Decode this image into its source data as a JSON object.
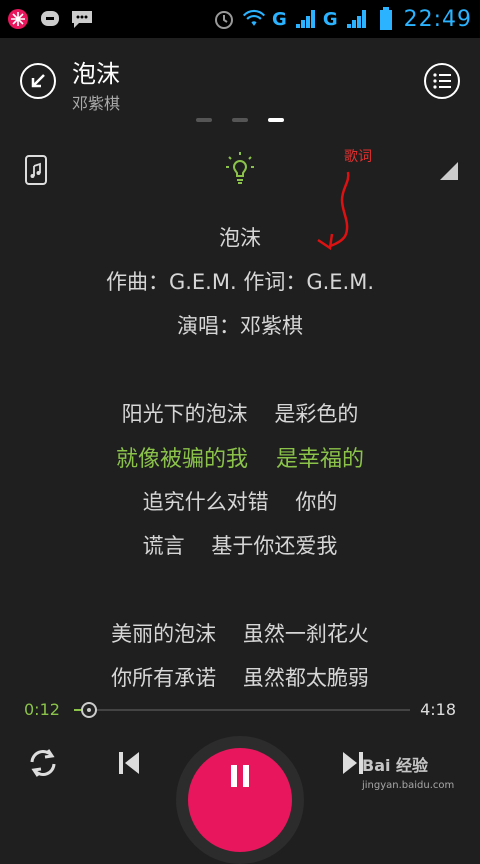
{
  "status_bar": {
    "time": "22:49",
    "network_1": "G",
    "network_2": "G",
    "sim_1": "1",
    "sim_2": "2",
    "icons": [
      "flower-icon",
      "chat-bubble-icon",
      "message-icon",
      "alarm-icon",
      "wifi-icon",
      "signal-icon",
      "battery-icon"
    ]
  },
  "header": {
    "title": "泡沫",
    "artist": "邓紫棋"
  },
  "pager": {
    "count": 3,
    "active_index": 2
  },
  "annotation": {
    "text": "歌词",
    "color": "#e0302f"
  },
  "lyrics": {
    "lines": [
      "泡沫",
      "作曲：G.E.M. 作词：G.E.M.",
      "演唱：邓紫棋",
      "",
      "阳光下的泡沫    是彩色的",
      "就像被骗的我    是幸福的",
      "追究什么对错    你的",
      "谎言    基于你还爱我",
      "",
      "美丽的泡沫    虽然一刹花火",
      "你所有承诺    虽然都太脆弱"
    ],
    "active_index": 5
  },
  "playback": {
    "current_time": "0:12",
    "total_time": "4:18",
    "progress_fraction": 0.046
  },
  "watermark": {
    "text": "Bai 经验",
    "url": "jingyan.baidu.com"
  },
  "colors": {
    "accent": "#8bc34a",
    "play_button": "#e8175d",
    "status_blue": "#2bb3ff",
    "background": "#1f1f1f"
  }
}
